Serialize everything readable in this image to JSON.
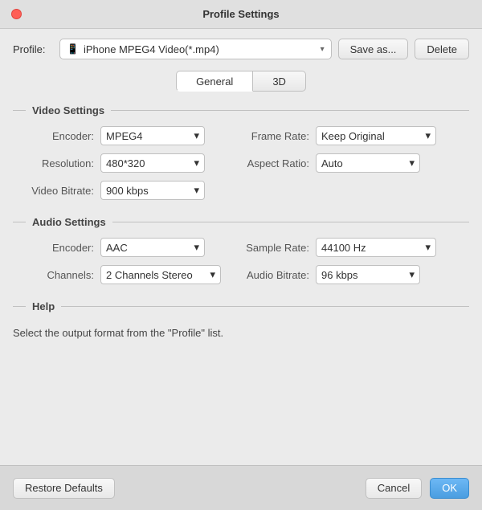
{
  "titleBar": {
    "title": "Profile Settings"
  },
  "profileRow": {
    "label": "Profile:",
    "selectedProfile": "iPhone MPEG4 Video(*.mp4)",
    "phoneIcon": "📱",
    "saveAsLabel": "Save as...",
    "deleteLabel": "Delete"
  },
  "tabs": [
    {
      "id": "general",
      "label": "General",
      "active": true
    },
    {
      "id": "3d",
      "label": "3D",
      "active": false
    }
  ],
  "videoSettings": {
    "sectionTitle": "Video Settings",
    "fields": {
      "encoder": {
        "label": "Encoder:",
        "value": "MPEG4"
      },
      "frameRate": {
        "label": "Frame Rate:",
        "value": "Keep Original"
      },
      "resolution": {
        "label": "Resolution:",
        "value": "480*320"
      },
      "aspectRatio": {
        "label": "Aspect Ratio:",
        "value": "Auto"
      },
      "videoBitrate": {
        "label": "Video Bitrate:",
        "value": "900 kbps"
      }
    }
  },
  "audioSettings": {
    "sectionTitle": "Audio Settings",
    "fields": {
      "encoder": {
        "label": "Encoder:",
        "value": "AAC"
      },
      "sampleRate": {
        "label": "Sample Rate:",
        "value": "44100 Hz"
      },
      "channels": {
        "label": "Channels:",
        "value": "2 Channels Stereo"
      },
      "audioBitrate": {
        "label": "Audio Bitrate:",
        "value": "96 kbps"
      }
    }
  },
  "help": {
    "sectionTitle": "Help",
    "text": "Select the output format from the \"Profile\" list."
  },
  "footer": {
    "restoreDefaultsLabel": "Restore Defaults",
    "cancelLabel": "Cancel",
    "okLabel": "OK"
  }
}
